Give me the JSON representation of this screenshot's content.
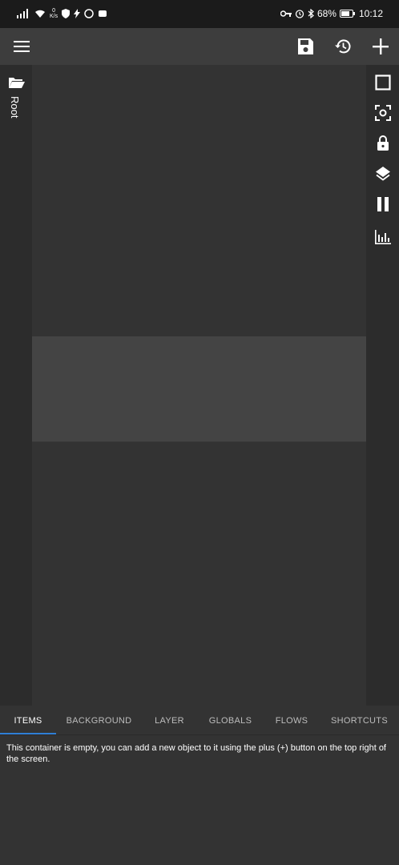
{
  "status_bar": {
    "netspeed_value": "0",
    "netspeed_unit": "K/s",
    "battery": "68%",
    "time": "10:12",
    "icons": [
      "signal-icon",
      "wifi-icon",
      "vpn-icon",
      "flash-icon",
      "data-icon",
      "cloud-icon",
      "key-icon",
      "alarm-icon",
      "bluetooth-icon",
      "battery-icon"
    ]
  },
  "toolbar": {
    "icons": [
      "menu-icon",
      "save-icon",
      "history-icon",
      "add-icon"
    ]
  },
  "left_panel": {
    "root_label": "Root",
    "icon": "folder-open-icon"
  },
  "right_panel": {
    "icons": [
      "select-box-icon",
      "focus-icon",
      "lock-icon",
      "layers-icon",
      "pause-icon",
      "stats-icon"
    ]
  },
  "tabs": [
    {
      "label": "ITEMS",
      "active": true
    },
    {
      "label": "BACKGROUND",
      "active": false
    },
    {
      "label": "LAYER",
      "active": false
    },
    {
      "label": "GLOBALS",
      "active": false
    },
    {
      "label": "FLOWS",
      "active": false
    },
    {
      "label": "SHORTCUTS",
      "active": false
    }
  ],
  "message": "This container is empty, you can add a new object to it using the plus (+) button on the top right of the screen.",
  "colors": {
    "accent": "#2f7fd6",
    "background": "#333333",
    "panel": "#2c2c2c"
  }
}
